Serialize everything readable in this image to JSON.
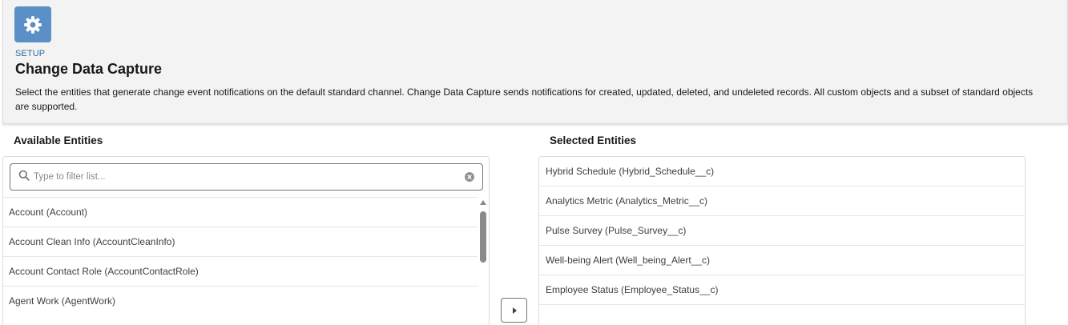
{
  "header": {
    "icon": "gear-icon",
    "icon_bg": "#5b8fc7",
    "eyebrow": "SETUP",
    "title": "Change Data Capture",
    "description": "Select the entities that generate change event notifications on the default standard channel. Change Data Capture sends notifications for created, updated, deleted, and undeleted records. All custom objects and a subset of standard objects are supported."
  },
  "available": {
    "label": "Available Entities",
    "search_placeholder": "Type to filter list...",
    "items": [
      "Account (Account)",
      "Account Clean Info (AccountCleanInfo)",
      "Account Contact Role (AccountContactRole)",
      "Agent Work (AgentWork)"
    ]
  },
  "selected": {
    "label": "Selected Entities",
    "items": [
      "Hybrid Schedule (Hybrid_Schedule__c)",
      "Analytics Metric (Analytics_Metric__c)",
      "Pulse Survey (Pulse_Survey__c)",
      "Well-being Alert (Well_being_Alert__c)",
      "Employee Status (Employee_Status__c)"
    ]
  },
  "move_button_icon": "chevron-right-icon"
}
